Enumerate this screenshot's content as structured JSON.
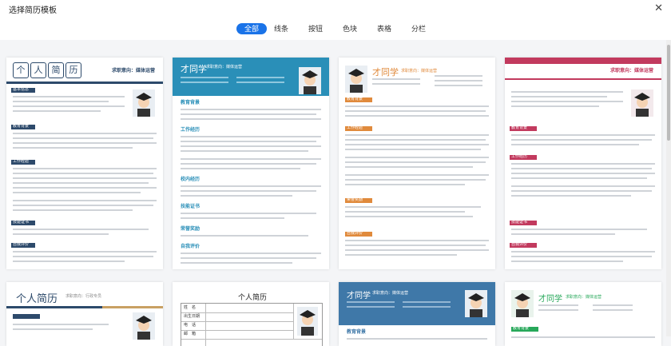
{
  "window": {
    "title": "选择简历模板",
    "close_icon": "close-icon"
  },
  "tabs": [
    {
      "label": "全部",
      "active": true
    },
    {
      "label": "线条",
      "active": false
    },
    {
      "label": "按钮",
      "active": false
    },
    {
      "label": "色块",
      "active": false
    },
    {
      "label": "表格",
      "active": false
    },
    {
      "label": "分栏",
      "active": false
    }
  ],
  "colors": {
    "accent": "#1a73e8",
    "navy": "#2d4a6b",
    "teal": "#2a8fb8",
    "orange": "#e08a3c",
    "crimson": "#c23a5e",
    "green": "#27a85a",
    "steel": "#3f78a8"
  },
  "templates": {
    "t1": {
      "name_chars": [
        "个",
        "人",
        "简",
        "历"
      ],
      "intent": "求职意向：媒体运营",
      "sections": [
        "基本信息",
        "教育背景",
        "工作经验",
        "技能证书",
        "自我评价"
      ]
    },
    "t2": {
      "name": "才同学",
      "intent": "求职意向：媒体运营",
      "sections": [
        "教育背景",
        "工作经历",
        "校内经历",
        "技能证书",
        "荣誉奖励",
        "自我评价"
      ]
    },
    "t3": {
      "name": "才同学",
      "intent": "求职意向：媒体运营",
      "sections": [
        "教育背景",
        "工作经验",
        "荣誉奖励",
        "自我评价"
      ]
    },
    "t4": {
      "intent": "求职意向：媒体运营",
      "sections": [
        "教育背景",
        "工作经历",
        "技能证书",
        "自我评价"
      ]
    },
    "t5": {
      "title": "个人简历",
      "intent": "求职意向：行政专员"
    },
    "t6": {
      "title": "个人简历",
      "row_labels": [
        "姓　名",
        "出生日期",
        "电　话",
        "邮　箱"
      ]
    },
    "t7": {
      "name": "才同学",
      "intent": "求职意向：媒体运营",
      "sections": [
        "教育背景"
      ]
    },
    "t8": {
      "name": "才同学",
      "intent": "求职意向：媒体运营",
      "sections": [
        "教育背景"
      ]
    }
  }
}
